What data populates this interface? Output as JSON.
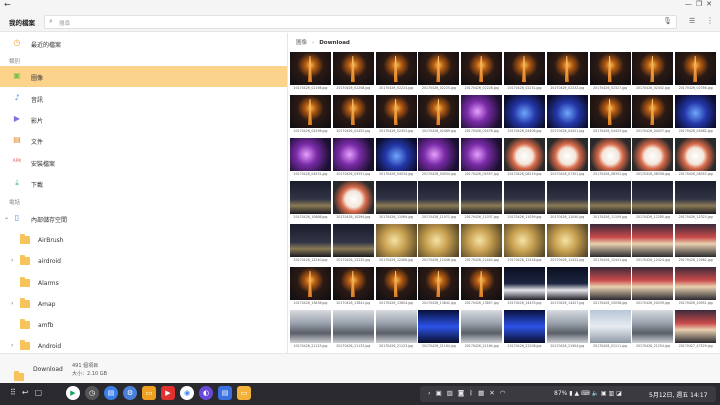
{
  "window": {
    "back_icon": "back-arrow-icon"
  },
  "appbar": {
    "title": "我的檔案",
    "search_placeholder": "搜尋"
  },
  "sidebar": {
    "recent": "最近的檔案",
    "section_category": "類別",
    "categories": [
      "圖像",
      "音訊",
      "影片",
      "文件",
      "安裝檔案",
      "下載"
    ],
    "apk_label": "APK",
    "section_phone": "電話",
    "storage": "內部儲存空間",
    "folders": [
      "AirBrush",
      "airdroid",
      "Alarms",
      "Amap",
      "amfb",
      "Android"
    ]
  },
  "breadcrumb": {
    "root": "圖像",
    "current": "Download"
  },
  "status": {
    "folder": "Download",
    "count": "491 個項目",
    "size": "大小：2.10 GB"
  },
  "grid": {
    "captions": [
      "20170426_02198.jpg",
      "20170426_02208.jpg",
      "20170426_02224.jpg",
      "20170426_02225.jpg",
      "20170426_02228.jpg",
      "20170426_02231.jpg",
      "20170426_02232.jpg",
      "20170426_02327.jpg",
      "20170426_02402.jpg",
      "20170426_02356.jpg",
      "20170426_02436.jpg",
      "20170426_02452.jpg",
      "20170426_02453.jpg",
      "20170426_02469.jpg",
      "20170426_02478.jpg",
      "20170426_04406.jpg",
      "20170426_04421.jpg",
      "20170426_04433.jpg",
      "20170426_04437.jpg",
      "20170426_04482.jpg",
      "20170426_04531.jpg",
      "20170426_04551.jpg",
      "20170426_04534.jpg",
      "20170426_04554.jpg",
      "20170426_04557.jpg",
      "20170426_08119.jpg",
      "20170426_07301.jpg",
      "20170426_08352.jpg",
      "20170426_08358.jpg",
      "20170426_08353.jpg",
      "20170426_10888.jpg",
      "20170426_10294.jpg",
      "20170426_11069.jpg",
      "20170426_11071.jpg",
      "20170426_11037.jpg",
      "20170426_11059.jpg",
      "20170426_11040.jpg",
      "20170426_11109.jpg",
      "20170426_12285.jpg",
      "20170426_12323.jpg",
      "20170426_12240.jpg",
      "20170426_12232.jpg",
      "20170426_12406.jpg",
      "20170426_12448.jpg",
      "20170426_12444.jpg",
      "20170426_12418.jpg",
      "20170426_12422.jpg",
      "20170426_12441.jpg",
      "20170426_12424.jpg",
      "20170426_12462.jpg",
      "20170426_13838.jpg",
      "20170426_13841.jpg",
      "20170426_13854.jpg",
      "20170426_13842.jpg",
      "20170426_13857.jpg",
      "20170426_14433.jpg",
      "20170426_14427.jpg",
      "20170426_20038.jpg",
      "20170426_20039.jpg",
      "20170426_20951.jpg",
      "20170426_21123.jpg",
      "20170426_21133.jpg",
      "20170426_21123.jpg",
      "20170426_21164.jpg",
      "20170426_21164.jpg",
      "20170426_21208.jpg",
      "20170426_21904.jpg",
      "20170426_01111.jpg",
      "20170426_21254.jpg",
      "20170427_47529.jpg",
      "",
      "",
      "",
      "",
      "",
      "",
      "",
      "",
      "",
      ""
    ]
  },
  "taskbar": {
    "battery": "87%",
    "clock": "5月12日, 週五 14:17"
  }
}
